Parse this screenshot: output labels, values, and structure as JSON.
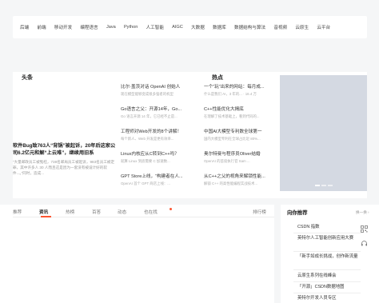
{
  "nav": {
    "items": [
      "后端",
      "前端",
      "移动开发",
      "编程语言",
      "Java",
      "Python",
      "人工智能",
      "AIGC",
      "大数据",
      "数据库",
      "数据结构与算法",
      "音视频",
      "云原生",
      "云平台"
    ]
  },
  "hero": {
    "headline_label": "头条",
    "hot_label": "热点",
    "headline": {
      "title": "软件Bug致763人“背锅”被起诉，20年后这家公司6.2亿元和解“上云难”，继续用旧系",
      "desc": "“大量邮政员工被冤枉，738名邮局员工被起诉，983名员工被定罪，其中许多人 30 人而且这是因为一套没有被设计好的软件...。”同时，造成..."
    },
    "col1": [
      {
        "title": "比尔·盖茨对话 OpenAI 创始人",
        "desc": "现在模型能够变成很多强者的机型"
      },
      {
        "title": "Go语言之父：开源14年，Go...",
        "desc": "Go 语言开源 14 年，它已经不止是..."
      },
      {
        "title": "工程师对Web开发的8个讲解！",
        "desc": "每个新人、Web 开发是更有效率..."
      },
      {
        "title": "Linux内核应从C转到C++吗？",
        "desc": "就算 Linux 到底需要 C 加速数..."
      },
      {
        "title": "GPT Store上线，“构建者在人...",
        "desc": "OpenAI 首个 GPT 商店上线：..."
      }
    ],
    "col2": [
      {
        "title": "一个“玩”出来的网站：每月成...",
        "desc": "什么是我们 AI，3 年的... · 16.4 万"
      },
      {
        "title": "C++性能优化大揭底",
        "desc": "在理解了技术基础上，看到代码的..."
      },
      {
        "title": "中国AI大模型专利数全球第一",
        "desc": "国内大模型专利在全球占比近 80%..."
      },
      {
        "title": "奥尔特曼与程序员Oliver结婚",
        "desc": "OpenAI 的首席执行官 Sam ..."
      },
      {
        "title": "从C++之父的视角来解锁性能...",
        "desc": "解锁 C++ 的高性能编程实战技术..."
      }
    ]
  },
  "feed": {
    "tabs": [
      "推荐",
      "资讯",
      "热榜",
      "百答",
      "动态",
      "也在找",
      "排行榜"
    ],
    "active_tab": "资讯"
  },
  "side": {
    "title": "向你推荐",
    "more": "换一换 ›",
    "items": [
      "CSDN 指数",
      "英特尔人工智能创新应用大赛",
      "「新手如成长挑战，创作新流量",
      "云原生系列在线峰会",
      "「开源」CSDN数据地图",
      "英特尔开发人员专区"
    ]
  },
  "rail": {
    "icons": [
      "qr-code-icon",
      "headset-icon"
    ]
  }
}
